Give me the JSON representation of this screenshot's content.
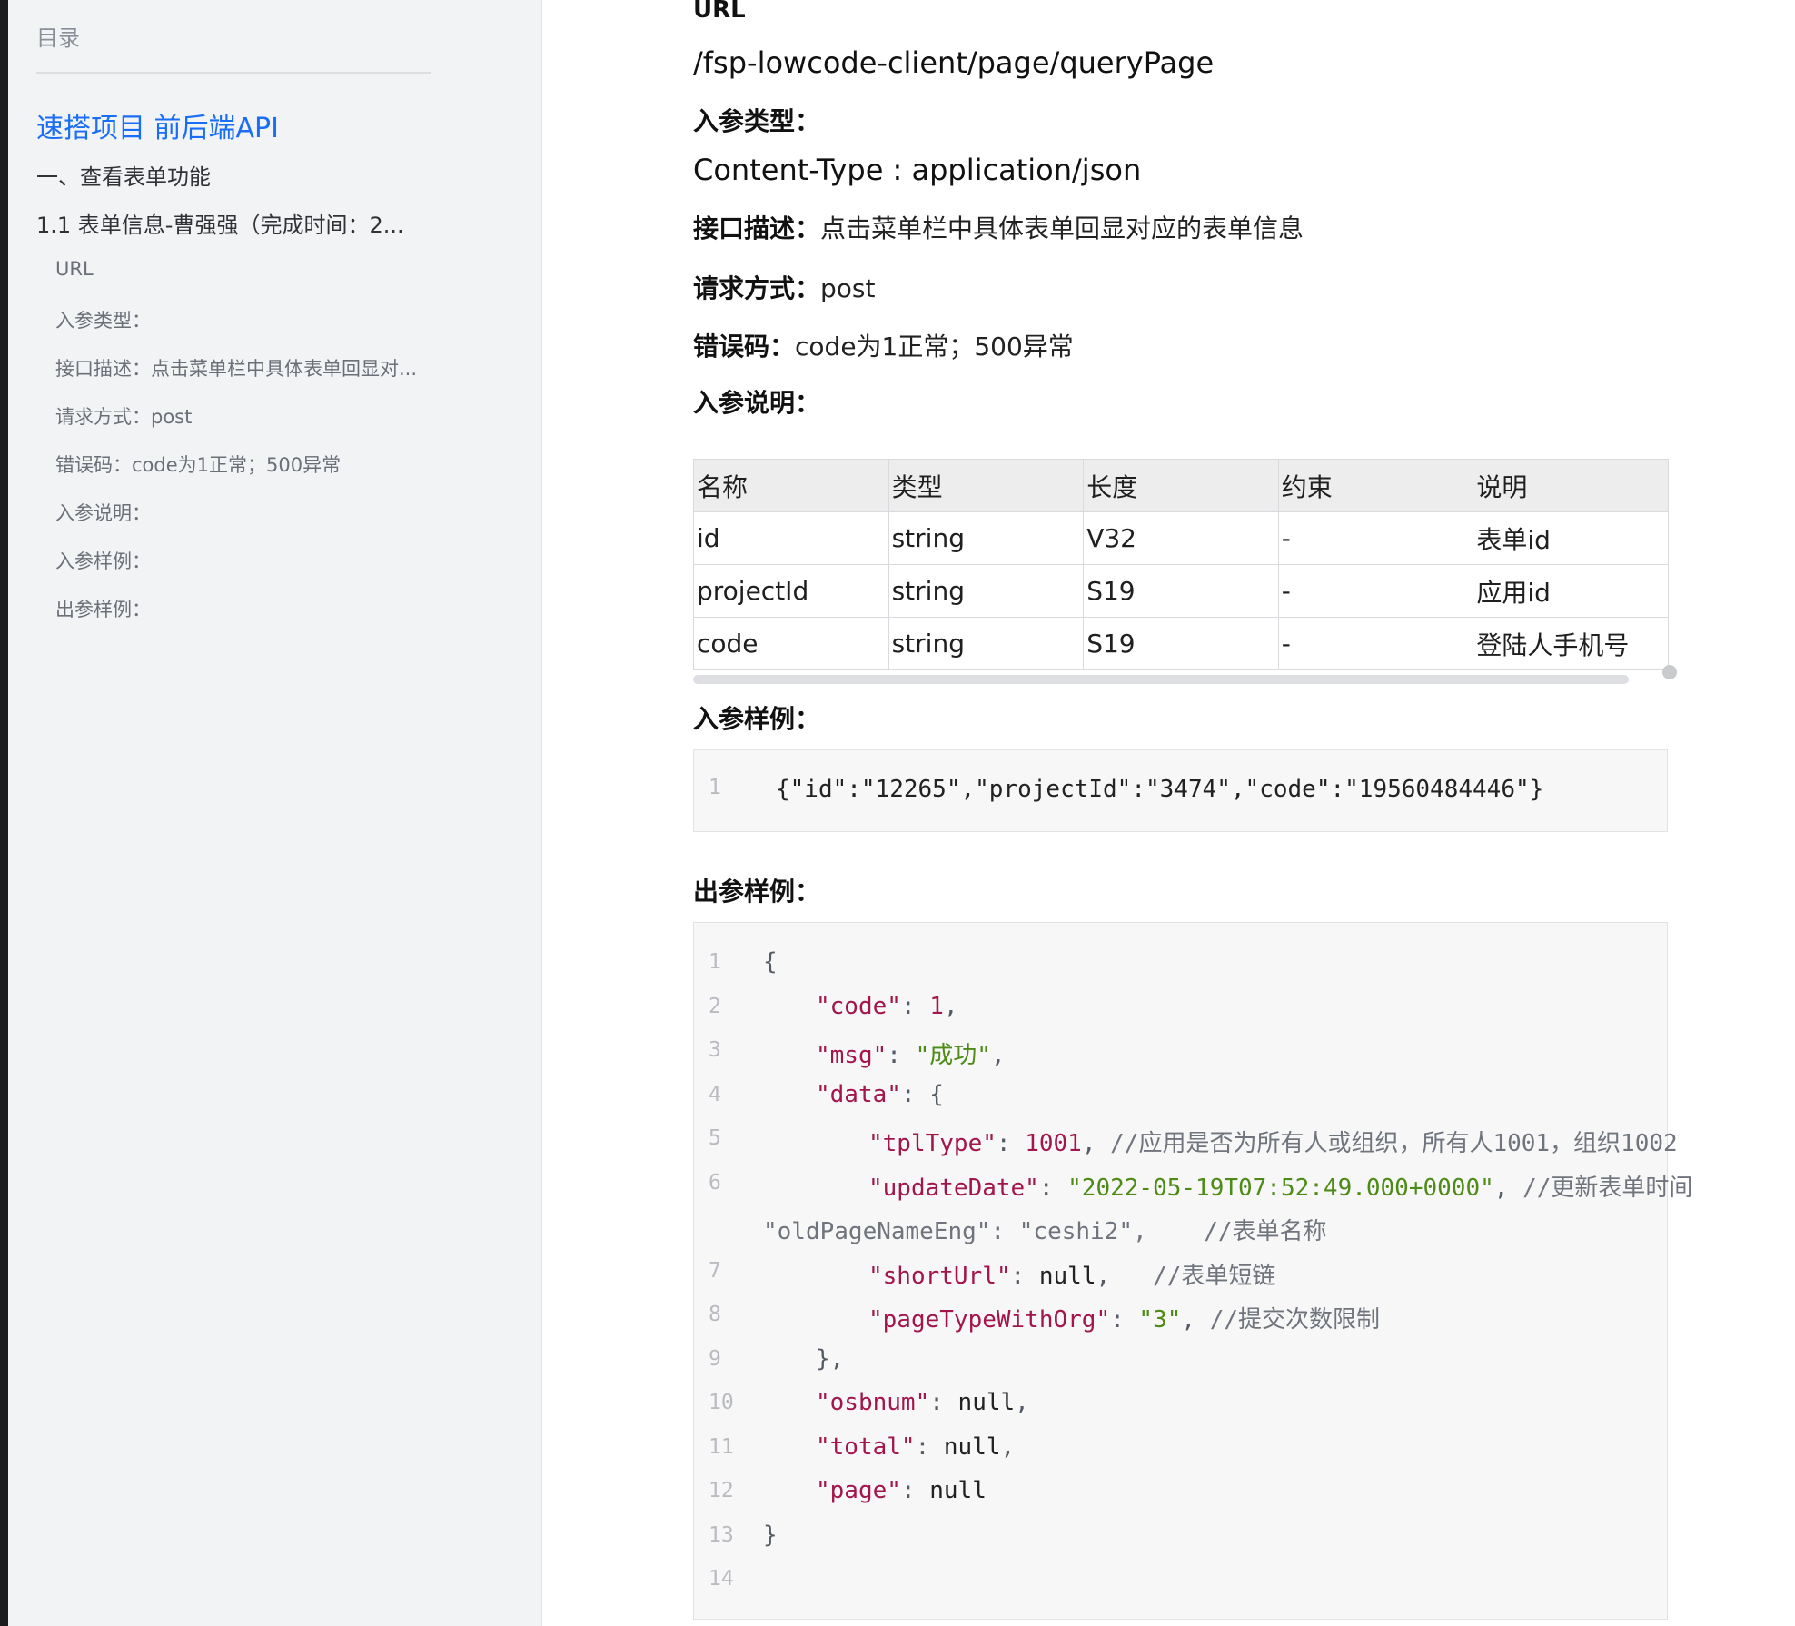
{
  "sidebar": {
    "title": "目录",
    "items": [
      {
        "label": "速搭项目  前后端API"
      },
      {
        "label": "一、查看表单功能"
      },
      {
        "label": "1.1   表单信息-曹强强（完成时间：2..."
      },
      {
        "label": "URL"
      },
      {
        "label": "入参类型："
      },
      {
        "label": "接口描述：点击菜单栏中具体表单回显对..."
      },
      {
        "label": "请求方式：post"
      },
      {
        "label": "错误码：code为1正常；500异常"
      },
      {
        "label": "入参说明："
      },
      {
        "label": "入参样例："
      },
      {
        "label": "出参样例："
      }
    ]
  },
  "doc": {
    "url_heading": "URL",
    "url_value": "/fsp-lowcode-client/page/queryPage",
    "param_type_label": "入参类型：",
    "param_type_value": "Content-Type : application/json",
    "desc_label": "接口描述：",
    "desc_value": "点击菜单栏中具体表单回显对应的表单信息",
    "method_label": "请求方式：",
    "method_value": "post",
    "error_label": "错误码：",
    "error_value": "code为1正常；500异常",
    "params_label": "入参说明：",
    "input_example_label": "入参样例：",
    "output_example_label": "出参样例："
  },
  "params_table": {
    "headers": [
      "名称",
      "类型",
      "长度",
      "约束",
      "说明"
    ],
    "rows": [
      [
        "id",
        "string",
        "V32",
        "-",
        "表单id"
      ],
      [
        "projectId",
        "string",
        "S19",
        "-",
        "应用id"
      ],
      [
        "code",
        "string",
        "S19",
        "-",
        "登陆人手机号"
      ]
    ]
  },
  "input_example": {
    "lines": [
      {
        "no": "1",
        "text": "{\"id\":\"12265\",\"projectId\":\"3474\",\"code\":\"19560484446\"}"
      }
    ]
  },
  "output_example": {
    "line_numbers": [
      "1",
      "2",
      "3",
      "4",
      "5",
      "6",
      "7",
      "8",
      "9",
      "10",
      "11",
      "12",
      "13",
      "14"
    ],
    "lines": [
      {
        "no": "1",
        "tokens": [
          [
            "p",
            "{"
          ]
        ]
      },
      {
        "no": "2",
        "tokens": [
          [
            "k",
            "\"code\""
          ],
          [
            "p",
            ": "
          ],
          [
            "n",
            "1"
          ],
          [
            "p",
            ","
          ]
        ]
      },
      {
        "no": "3",
        "tokens": [
          [
            "k",
            "\"msg\""
          ],
          [
            "p",
            ": "
          ],
          [
            "s",
            "\"成功\""
          ],
          [
            "p",
            ","
          ]
        ]
      },
      {
        "no": "4",
        "tokens": [
          [
            "k",
            "\"data\""
          ],
          [
            "p",
            ": {"
          ]
        ]
      },
      {
        "no": "5",
        "tokens": [
          [
            "k",
            "\"tplType\""
          ],
          [
            "p",
            ": "
          ],
          [
            "n",
            "1001"
          ],
          [
            "p",
            ", "
          ],
          [
            "c",
            "//应用是否为所有人或组织，所有人1001，组织1002"
          ]
        ]
      },
      {
        "no": "6",
        "tokens": [
          [
            "k",
            "\"updateDate\""
          ],
          [
            "p",
            ": "
          ],
          [
            "s",
            "\"2022-05-19T07:52:49.000+0000\""
          ],
          [
            "p",
            ", "
          ],
          [
            "c",
            "//更新表单时间"
          ]
        ]
      },
      {
        "no": "",
        "tokens": [
          [
            "c",
            "\"oldPageNameEng\": \"ceshi2\",    //表单名称"
          ]
        ]
      },
      {
        "no": "7",
        "tokens": [
          [
            "k",
            "\"shortUrl\""
          ],
          [
            "p",
            ": "
          ],
          [
            "d",
            "null"
          ],
          [
            "p",
            ",   "
          ],
          [
            "c",
            "//表单短链"
          ]
        ]
      },
      {
        "no": "8",
        "tokens": [
          [
            "k",
            "\"pageTypeWithOrg\""
          ],
          [
            "p",
            ": "
          ],
          [
            "s",
            "\"3\""
          ],
          [
            "p",
            ", "
          ],
          [
            "c",
            "//提交次数限制"
          ]
        ]
      },
      {
        "no": "9",
        "tokens": [
          [
            "p",
            "},"
          ]
        ]
      },
      {
        "no": "10",
        "tokens": [
          [
            "k",
            "\"osbnum\""
          ],
          [
            "p",
            ": "
          ],
          [
            "d",
            "null"
          ],
          [
            "p",
            ","
          ]
        ]
      },
      {
        "no": "11",
        "tokens": [
          [
            "k",
            "\"total\""
          ],
          [
            "p",
            ": "
          ],
          [
            "d",
            "null"
          ],
          [
            "p",
            ","
          ]
        ]
      },
      {
        "no": "12",
        "tokens": [
          [
            "k",
            "\"page\""
          ],
          [
            "p",
            ": "
          ],
          [
            "d",
            "null"
          ]
        ]
      },
      {
        "no": "13",
        "tokens": [
          [
            "p",
            "}"
          ]
        ]
      },
      {
        "no": "14",
        "tokens": []
      }
    ]
  },
  "colors": {
    "accent": "#1a6ef5",
    "key": "#a3164b",
    "string": "#4d8b16",
    "comment": "#6f747d"
  }
}
